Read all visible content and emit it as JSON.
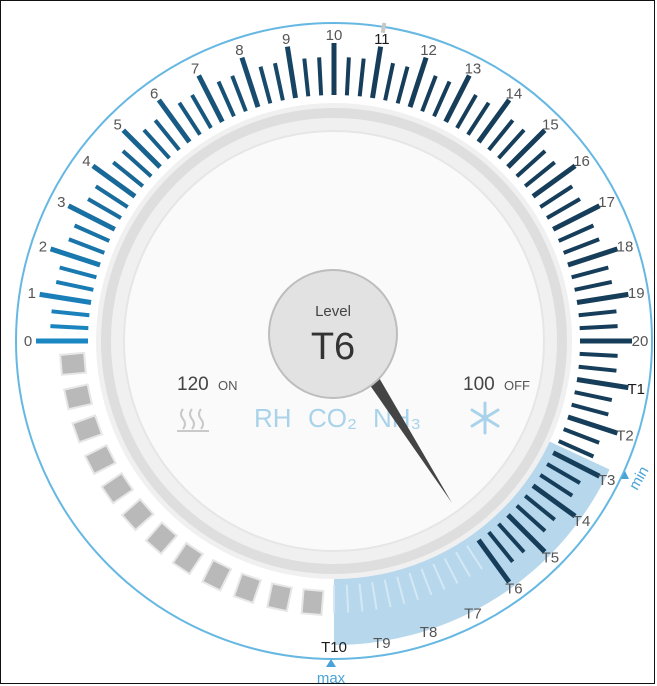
{
  "level": {
    "label": "Level",
    "value": "T6"
  },
  "heat": {
    "value": "120",
    "state": "ON",
    "icon": "heat-icon"
  },
  "cool": {
    "value": "100",
    "state": "OFF",
    "icon": "snowflake-icon"
  },
  "modes": [
    {
      "name": "rh",
      "text": "RH"
    },
    {
      "name": "co2",
      "text": "CO₂"
    },
    {
      "name": "nh3",
      "text": "NH₃"
    }
  ],
  "markers": {
    "min": "min",
    "max": "max"
  },
  "scale_labels": [
    "0",
    "1",
    "2",
    "3",
    "4",
    "5",
    "6",
    "7",
    "8",
    "9",
    "10",
    "11",
    "12",
    "13",
    "14",
    "15",
    "16",
    "17",
    "18",
    "19",
    "20",
    "T1",
    "T2",
    "T3",
    "T4",
    "T5",
    "T6",
    "T7",
    "T8",
    "T9",
    "T10"
  ],
  "current_index": 11,
  "colors": {
    "tick_light": "#1a86c2",
    "tick_dark": "#163e5a",
    "zone": "#aed3ea",
    "outer_ring": "#66b8e2",
    "marker": "#4aa3d6",
    "pointer": "#444444"
  }
}
